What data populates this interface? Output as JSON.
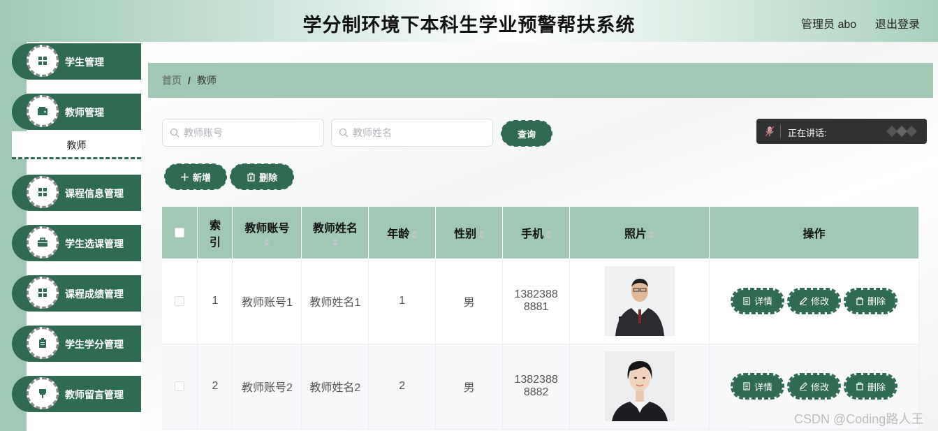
{
  "header": {
    "title": "学分制环境下本科生学业预警帮扶系统",
    "user": "管理员 abo",
    "logout": "退出登录"
  },
  "sidebar": {
    "items": [
      {
        "label": "学生管理",
        "icon": "grid-icon"
      },
      {
        "label": "教师管理",
        "icon": "wallet-icon"
      },
      {
        "label": "课程信息管理",
        "icon": "grid-icon"
      },
      {
        "label": "学生选课管理",
        "icon": "briefcase-icon"
      },
      {
        "label": "课程成绩管理",
        "icon": "grid-icon"
      },
      {
        "label": "学生学分管理",
        "icon": "clipboard-icon"
      },
      {
        "label": "教师留言管理",
        "icon": "pin-icon"
      }
    ],
    "submenu": {
      "label": "教师"
    }
  },
  "breadcrumb": {
    "home": "首页",
    "separator": "/",
    "current": "教师"
  },
  "search": {
    "account_placeholder": "教师账号",
    "name_placeholder": "教师姓名",
    "query_label": "查询"
  },
  "actions": {
    "add_label": "新增",
    "delete_label": "删除"
  },
  "voice": {
    "label": "正在讲话:"
  },
  "table": {
    "headers": {
      "index_line1": "索",
      "index_line2": "引",
      "account": "教师账号",
      "name": "教师姓名",
      "age": "年龄",
      "gender": "性别",
      "phone": "手机",
      "photo": "照片",
      "ops": "操作"
    },
    "rows": [
      {
        "index": "1",
        "account": "教师账号1",
        "name": "教师姓名1",
        "age": "1",
        "gender": "男",
        "phone_line1": "1382388",
        "phone_line2": "8881"
      },
      {
        "index": "2",
        "account": "教师账号2",
        "name": "教师姓名2",
        "age": "2",
        "gender": "男",
        "phone_line1": "1382388",
        "phone_line2": "8882"
      }
    ],
    "op_labels": {
      "detail": "详情",
      "edit": "修改",
      "delete": "删除"
    }
  },
  "watermark": "CSDN @Coding路人王",
  "colors": {
    "primary": "#2f6a52",
    "accent": "#9fc9b5"
  }
}
